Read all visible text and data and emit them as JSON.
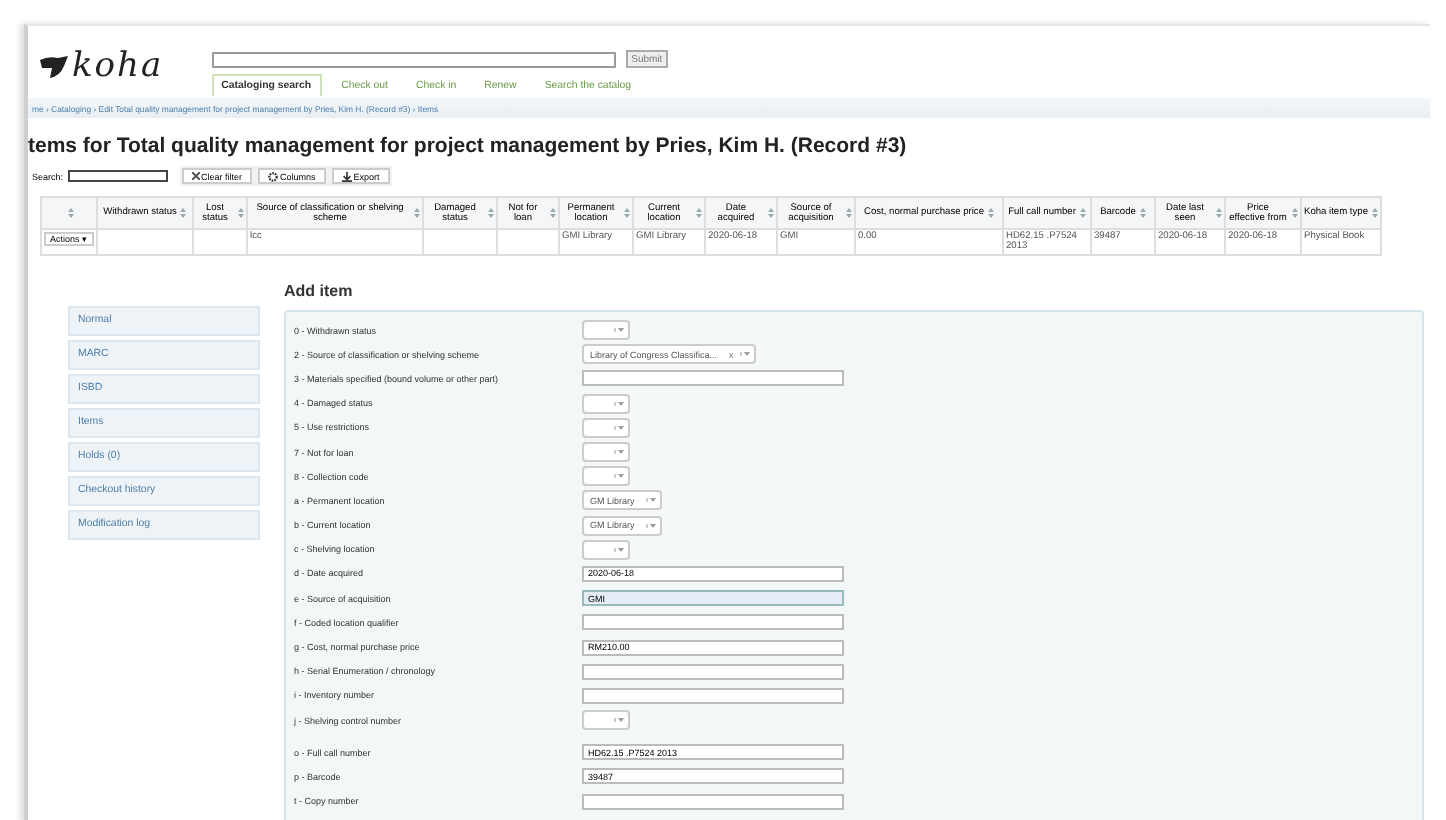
{
  "header": {
    "logo": "koha",
    "submit": "Submit",
    "nav": [
      {
        "label": "Cataloging search",
        "selected": true
      },
      {
        "label": "Check out",
        "selected": false
      },
      {
        "label": "Check in",
        "selected": false
      },
      {
        "label": "Renew",
        "selected": false
      },
      {
        "label": "Search the catalog",
        "selected": false
      }
    ]
  },
  "breadcrumb": "me › Cataloging › Edit Total quality management for project management by Pries, Kim H. (Record #3) › Items",
  "heading": "tems for Total quality management for project management by Pries, Kim H. (Record #3)",
  "toolbar": {
    "search_label": "Search:",
    "buttons": [
      {
        "kind": "clear",
        "label": "Clear filter"
      },
      {
        "kind": "columns",
        "label": "Columns"
      },
      {
        "kind": "export",
        "label": "Export"
      }
    ]
  },
  "table": {
    "columns": [
      "",
      "Withdrawn status",
      "Lost status",
      "Source of classification or shelving scheme",
      "Damaged status",
      "Not for loan",
      "Permanent location",
      "Current location",
      "Date acquired",
      "Source of acquisition",
      "Cost, normal purchase price",
      "Full call number",
      "Barcode",
      "Date last seen",
      "Price effective from",
      "Koha item type"
    ],
    "rows": [
      {
        "cells": [
          "Actions ▾",
          "",
          "",
          "lcc",
          "",
          "",
          "GMI Library",
          "GMI Library",
          "2020-06-18",
          "GMI",
          "0.00",
          "HD62.15 .P7524 2013",
          "39487",
          "2020-06-18",
          "2020-06-18",
          "Physical Book"
        ]
      }
    ]
  },
  "sidebar": {
    "items": [
      "Normal",
      "MARC",
      "ISBD",
      "Items",
      "Holds (0)",
      "Checkout history",
      "Modification log"
    ]
  },
  "form": {
    "title": "Add item",
    "fields": [
      {
        "label": "0 - Withdrawn status",
        "kind": "select"
      },
      {
        "label": "2 - Source of classification or shelving scheme",
        "kind": "select",
        "value": "Library of Congress Classifica...",
        "clear": "x"
      },
      {
        "label": "3 - Materials specified (bound volume or other part)",
        "kind": "text"
      },
      {
        "label": "4 - Damaged status",
        "kind": "select"
      },
      {
        "label": "5 - Use restrictions",
        "kind": "select"
      },
      {
        "label": "7 - Not for loan",
        "kind": "select"
      },
      {
        "label": "8 - Collection code",
        "kind": "select"
      },
      {
        "label": "a - Permanent location",
        "kind": "select",
        "value": "GM Library"
      },
      {
        "label": "b - Current location",
        "kind": "select",
        "value": "GM Library"
      },
      {
        "label": "c - Shelving location",
        "kind": "select"
      },
      {
        "label": "d - Date acquired",
        "kind": "text",
        "value": "2020-06-18"
      },
      {
        "label": "e - Source of acquisition",
        "kind": "text",
        "value": "GMI",
        "focused": true
      },
      {
        "label": "f - Coded location qualifier",
        "kind": "text"
      },
      {
        "label": "g - Cost, normal purchase price",
        "kind": "text",
        "value": "RM210.00"
      },
      {
        "label": "h - Serial Enumeration / chronology",
        "kind": "text"
      },
      {
        "label": "i - Inventory number",
        "kind": "text"
      },
      {
        "label": "j - Shelving control number",
        "kind": "select"
      },
      {
        "label": "o - Full call number",
        "kind": "text",
        "value": "HD62.15 .P7524 2013"
      },
      {
        "label": "p - Barcode",
        "kind": "text",
        "value": "39487"
      },
      {
        "label": "t - Copy number",
        "kind": "text"
      }
    ]
  }
}
